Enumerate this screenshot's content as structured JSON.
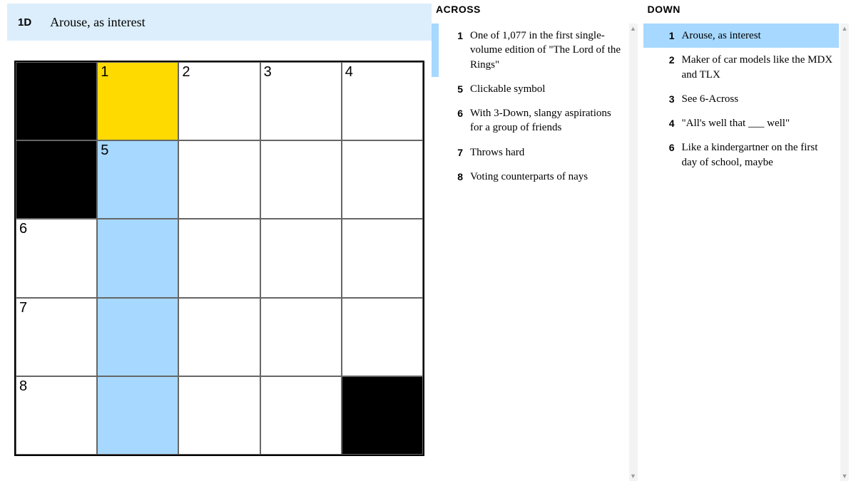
{
  "cluebar": {
    "id": "1D",
    "text": "Arouse, as interest"
  },
  "grid": {
    "rows": 5,
    "cols": 5,
    "cells": [
      {
        "r": 0,
        "c": 0,
        "black": true
      },
      {
        "r": 0,
        "c": 1,
        "num": "1",
        "state": "current"
      },
      {
        "r": 0,
        "c": 2,
        "num": "2"
      },
      {
        "r": 0,
        "c": 3,
        "num": "3"
      },
      {
        "r": 0,
        "c": 4,
        "num": "4"
      },
      {
        "r": 1,
        "c": 0,
        "black": true
      },
      {
        "r": 1,
        "c": 1,
        "num": "5",
        "state": "highlight"
      },
      {
        "r": 1,
        "c": 2
      },
      {
        "r": 1,
        "c": 3
      },
      {
        "r": 1,
        "c": 4
      },
      {
        "r": 2,
        "c": 0,
        "num": "6"
      },
      {
        "r": 2,
        "c": 1,
        "state": "highlight"
      },
      {
        "r": 2,
        "c": 2
      },
      {
        "r": 2,
        "c": 3
      },
      {
        "r": 2,
        "c": 4
      },
      {
        "r": 3,
        "c": 0,
        "num": "7"
      },
      {
        "r": 3,
        "c": 1,
        "state": "highlight"
      },
      {
        "r": 3,
        "c": 2
      },
      {
        "r": 3,
        "c": 3
      },
      {
        "r": 3,
        "c": 4
      },
      {
        "r": 4,
        "c": 0,
        "num": "8"
      },
      {
        "r": 4,
        "c": 1,
        "state": "highlight"
      },
      {
        "r": 4,
        "c": 2
      },
      {
        "r": 4,
        "c": 3
      },
      {
        "r": 4,
        "c": 4,
        "black": true
      }
    ]
  },
  "across": {
    "heading": "ACROSS",
    "clues": [
      {
        "num": "1",
        "text": "One of 1,077 in the first single-volume edition of \"The Lord of the Rings\"",
        "sel": "secondary"
      },
      {
        "num": "5",
        "text": "Clickable symbol"
      },
      {
        "num": "6",
        "text": "With 3-Down, slangy aspirations for a group of friends"
      },
      {
        "num": "7",
        "text": "Throws hard"
      },
      {
        "num": "8",
        "text": "Voting counterparts of nays"
      }
    ]
  },
  "down": {
    "heading": "DOWN",
    "clues": [
      {
        "num": "1",
        "text": "Arouse, as interest",
        "sel": "primary"
      },
      {
        "num": "2",
        "text": "Maker of car models like the MDX and TLX"
      },
      {
        "num": "3",
        "text": "See 6-Across"
      },
      {
        "num": "4",
        "text": "\"All's well that ___ well\""
      },
      {
        "num": "6",
        "text": "Like a kindergartner on the first day of school, maybe"
      }
    ]
  },
  "glyphs": {
    "up": "▲",
    "down": "▼"
  }
}
